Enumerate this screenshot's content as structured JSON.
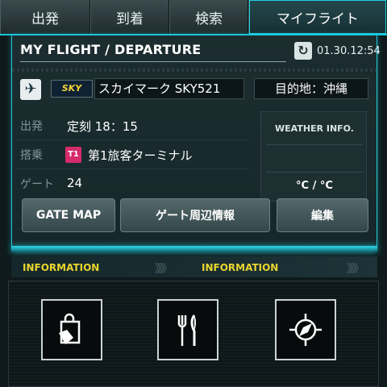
{
  "tabs": [
    {
      "label": "出発"
    },
    {
      "label": "到着"
    },
    {
      "label": "検索"
    },
    {
      "label": "マイフライト"
    }
  ],
  "header": {
    "title": "MY FLIGHT / DEPARTURE",
    "timestamp": "01.30.12:54"
  },
  "flight": {
    "airline_logo_text": "SKY",
    "airline_flight": "スカイマーク SKY521",
    "destination": "目的地：沖縄"
  },
  "details": {
    "departure_label": "出発",
    "departure_value": "定刻 18：15",
    "boarding_label": "搭乗",
    "terminal_badge": "T1",
    "boarding_value": "第1旅客ターミナル",
    "gate_label": "ゲート",
    "gate_value": "24"
  },
  "weather": {
    "title": "WEATHER INFO.",
    "temperature": "°C / °C"
  },
  "buttons": {
    "gate_map": "GATE MAP",
    "gate_area": "ゲート周辺情報",
    "edit": "編集"
  },
  "info_strip": {
    "left": "INFORMATION",
    "right": "INFORMATION",
    "chevrons": "》》》"
  },
  "colors": {
    "accent_cyan": "#16c7d9",
    "info_yellow": "#e8d52f",
    "terminal_pink": "#d52b6c"
  },
  "icons": [
    "shopping-bag-icon",
    "restaurant-icon",
    "compass-icon"
  ]
}
